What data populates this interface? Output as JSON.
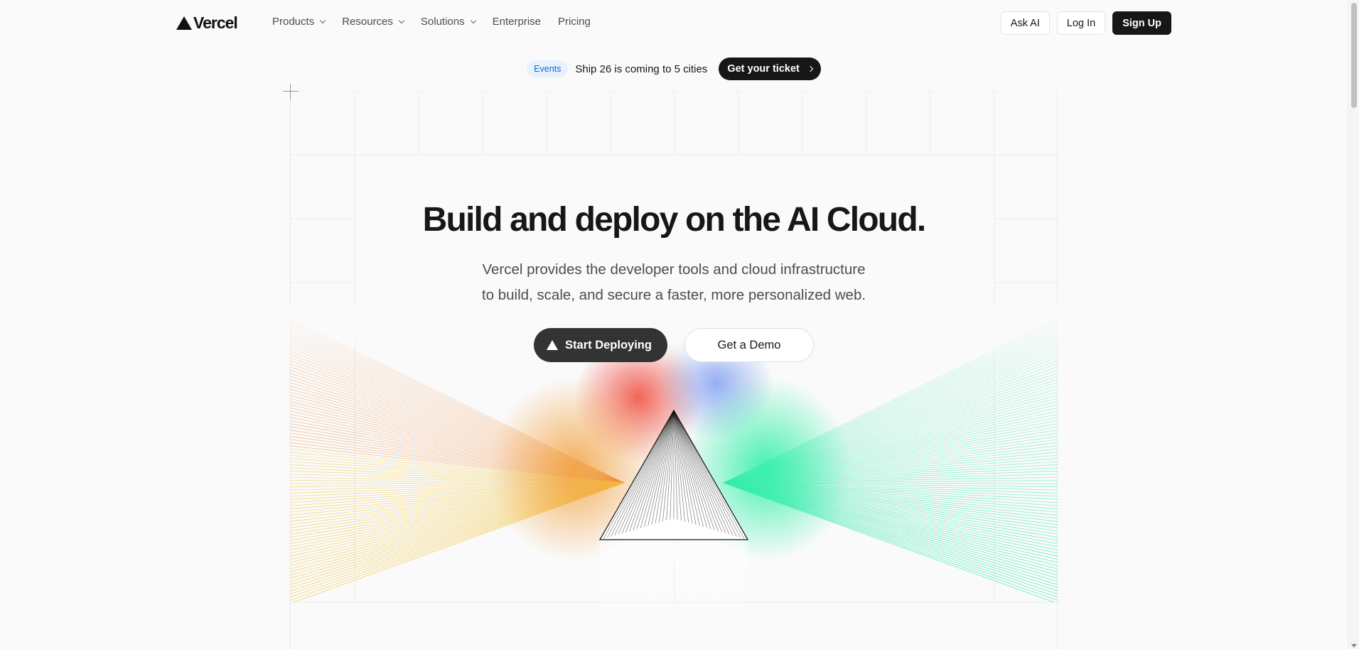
{
  "brand": {
    "name": "Vercel"
  },
  "nav": {
    "items": [
      {
        "label": "Products",
        "dropdown": true
      },
      {
        "label": "Resources",
        "dropdown": true
      },
      {
        "label": "Solutions",
        "dropdown": true
      },
      {
        "label": "Enterprise",
        "dropdown": false
      },
      {
        "label": "Pricing",
        "dropdown": false
      }
    ],
    "ask_ai": "Ask AI",
    "log_in": "Log In",
    "sign_up": "Sign Up"
  },
  "banner": {
    "badge": "Events",
    "text": "Ship 26 is coming to 5 cities",
    "cta": "Get your ticket"
  },
  "hero": {
    "title": "Build and deploy on the AI Cloud.",
    "subtitle_line1": "Vercel provides the developer tools and cloud infrastructure",
    "subtitle_line2": "to build, scale, and secure a faster, more personalized web.",
    "primary_cta": "Start Deploying",
    "secondary_cta": "Get a Demo"
  },
  "colors": {
    "accent_dark": "#171717",
    "events_badge_bg": "#e8f2fe",
    "events_badge_text": "#0a6bd6",
    "ray_orange": "#f08a3c",
    "ray_yellow": "#f2c744",
    "ray_green": "#3de8b0",
    "glow_red": "#f04a3c",
    "glow_blue": "#6a8ff0"
  },
  "icons": {
    "logo": "triangle-logo-icon",
    "dropdown": "chevron-down-icon",
    "banner_arrow": "chevron-right-icon",
    "deploy": "triangle-icon"
  }
}
